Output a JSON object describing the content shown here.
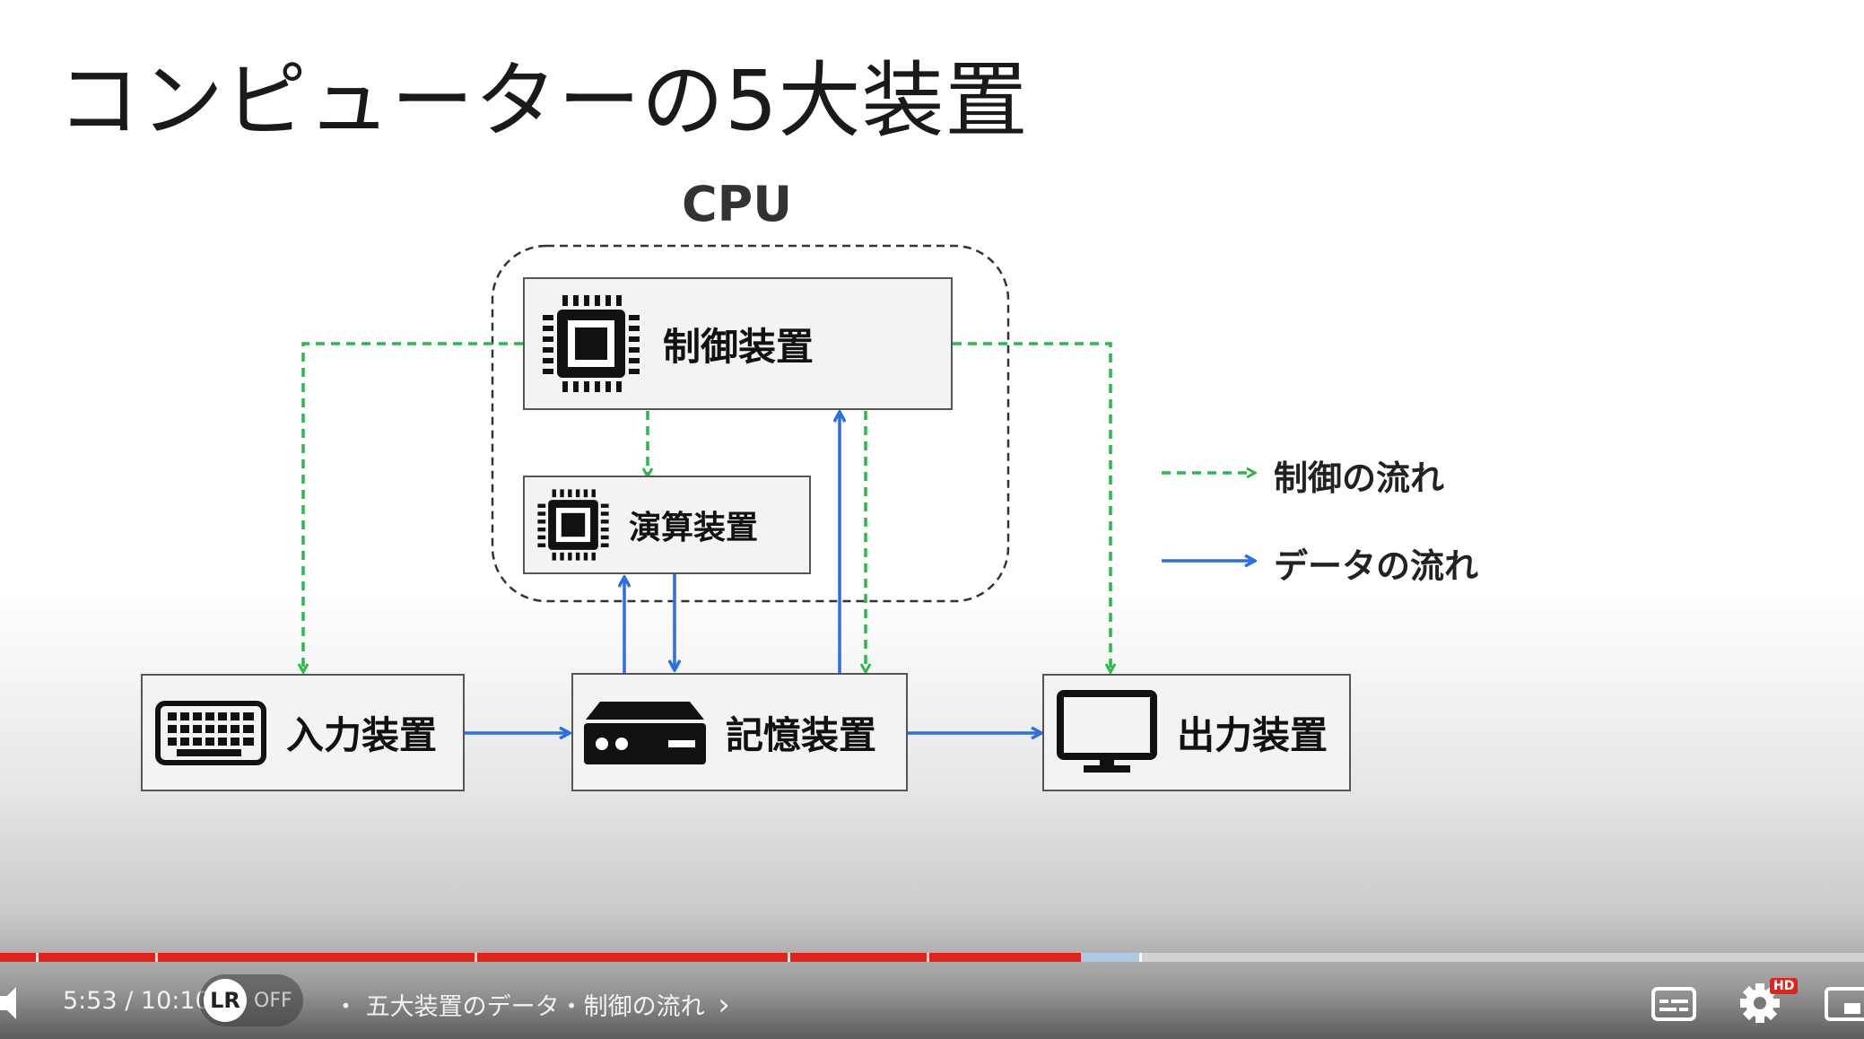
{
  "slide": {
    "title": "コンピューターの5大装置",
    "cpu_label": "CPU",
    "units": {
      "control": "制御装置",
      "alu": "演算装置",
      "input": "入力装置",
      "memory": "記憶装置",
      "output": "出力装置"
    },
    "legend": {
      "control_flow": "制御の流れ",
      "data_flow": "データの流れ"
    },
    "colors": {
      "control_flow": "#2db84d",
      "data_flow": "#2b6fe0"
    }
  },
  "player": {
    "current_time": "5:53",
    "separator": " / ",
    "duration": "10:10",
    "progress_fraction": 0.58,
    "toggle_state": "OFF",
    "chapter_prefix": "・",
    "chapter_title": "五大装置のデータ・制御の流れ",
    "chapter_chevron": "›",
    "icons": [
      "volume-icon",
      "subtitles-icon",
      "settings-icon",
      "miniplayer-icon"
    ],
    "hd_badge": "HD"
  }
}
